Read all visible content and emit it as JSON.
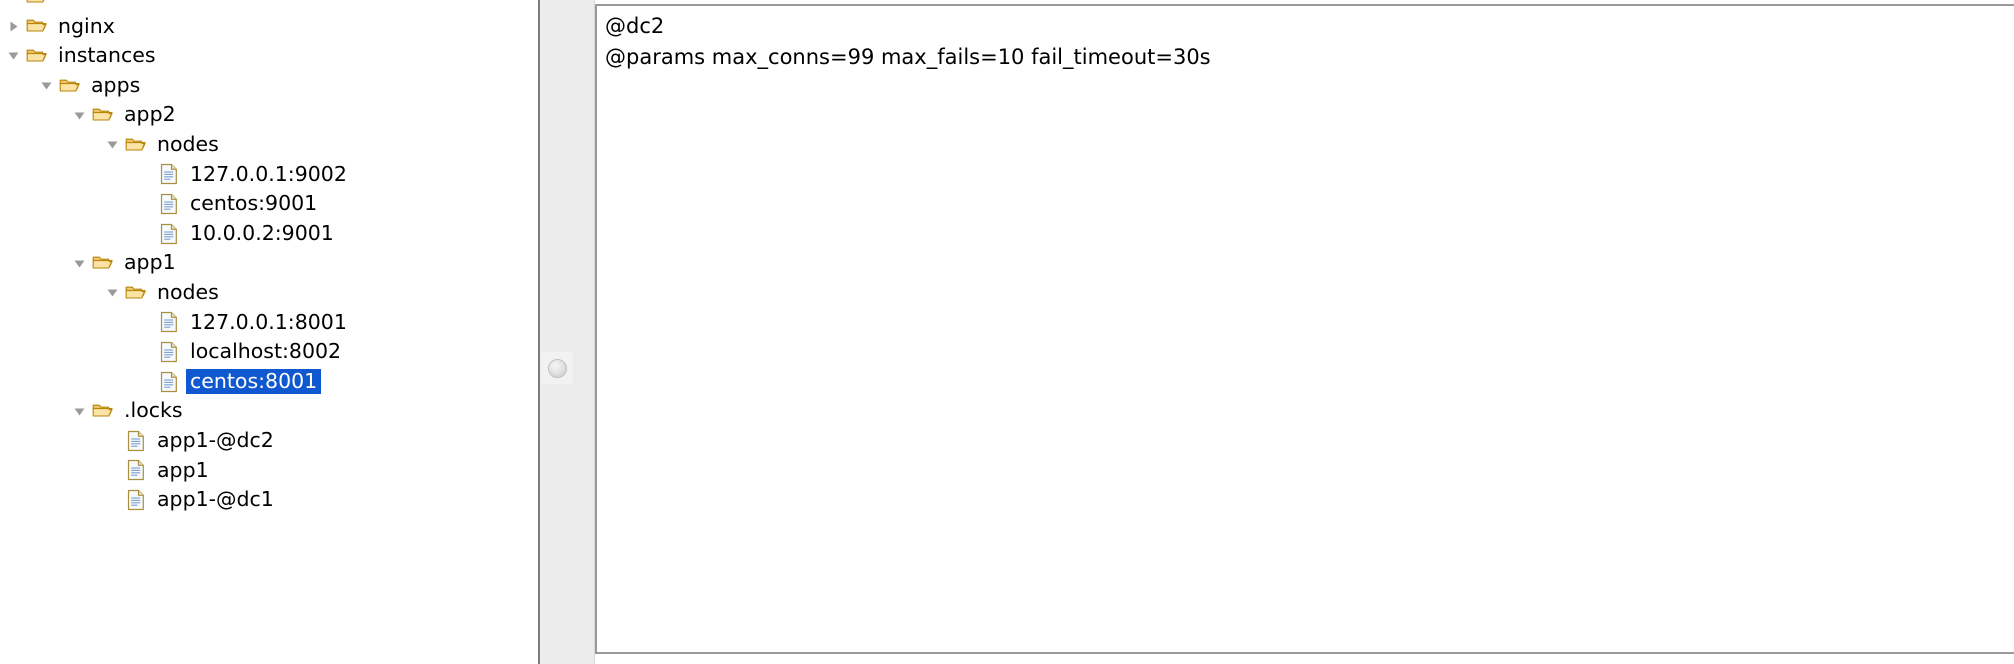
{
  "tree": {
    "rows": [
      {
        "label": "",
        "depth": 1,
        "type": "folder",
        "state": "none",
        "partial": true,
        "selected": false
      },
      {
        "label": "nginx",
        "depth": 1,
        "type": "folder",
        "state": "collapsed",
        "partial": false,
        "selected": false
      },
      {
        "label": "instances",
        "depth": 1,
        "type": "folder",
        "state": "expanded",
        "partial": false,
        "selected": false
      },
      {
        "label": "apps",
        "depth": 2,
        "type": "folder",
        "state": "expanded",
        "partial": false,
        "selected": false
      },
      {
        "label": "app2",
        "depth": 3,
        "type": "folder",
        "state": "expanded",
        "partial": false,
        "selected": false
      },
      {
        "label": "nodes",
        "depth": 4,
        "type": "folder",
        "state": "expanded",
        "partial": false,
        "selected": false
      },
      {
        "label": "127.0.0.1:9002",
        "depth": 5,
        "type": "file",
        "state": "none",
        "partial": false,
        "selected": false
      },
      {
        "label": "centos:9001",
        "depth": 5,
        "type": "file",
        "state": "none",
        "partial": false,
        "selected": false
      },
      {
        "label": "10.0.0.2:9001",
        "depth": 5,
        "type": "file",
        "state": "none",
        "partial": false,
        "selected": false
      },
      {
        "label": "app1",
        "depth": 3,
        "type": "folder",
        "state": "expanded",
        "partial": false,
        "selected": false
      },
      {
        "label": "nodes",
        "depth": 4,
        "type": "folder",
        "state": "expanded",
        "partial": false,
        "selected": false
      },
      {
        "label": "127.0.0.1:8001",
        "depth": 5,
        "type": "file",
        "state": "none",
        "partial": false,
        "selected": false
      },
      {
        "label": "localhost:8002",
        "depth": 5,
        "type": "file",
        "state": "none",
        "partial": false,
        "selected": false
      },
      {
        "label": "centos:8001",
        "depth": 5,
        "type": "file",
        "state": "none",
        "partial": false,
        "selected": true
      },
      {
        "label": ".locks",
        "depth": 3,
        "type": "folder",
        "state": "expanded",
        "partial": false,
        "selected": false
      },
      {
        "label": "app1-@dc2",
        "depth": 4,
        "type": "file",
        "state": "none",
        "partial": false,
        "selected": false
      },
      {
        "label": "app1",
        "depth": 4,
        "type": "file",
        "state": "none",
        "partial": false,
        "selected": false
      },
      {
        "label": "app1-@dc1",
        "depth": 4,
        "type": "file",
        "state": "none",
        "partial": false,
        "selected": false
      }
    ],
    "selection_color": "#1058d0",
    "selection_text_color": "#ffffff",
    "folder_icon": "folder-open-icon",
    "file_icon": "document-icon",
    "expanded_icon": "triangle-down-icon",
    "collapsed_icon": "triangle-right-icon"
  },
  "splitter": {
    "grip_icon": "splitter-grip-dot-icon"
  },
  "editor": {
    "lines": [
      "@dc2",
      "@params max_conns=99 max_fails=10 fail_timeout=30s"
    ],
    "value": "@dc2\n@params max_conns=99 max_fails=10 fail_timeout=30s"
  }
}
